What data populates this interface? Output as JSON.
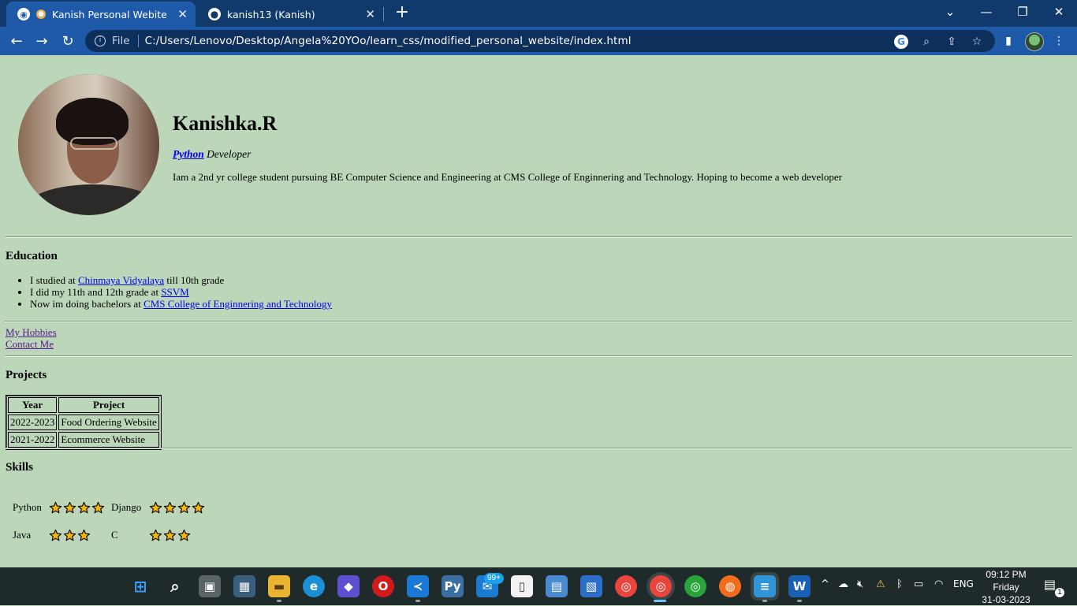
{
  "browser": {
    "tabs": [
      {
        "title": "Kanish Personal Webite",
        "active": true
      },
      {
        "title": "kanish13 (Kanish)",
        "active": false
      }
    ],
    "omnibox": {
      "scheme_label": "File",
      "url": "C:/Users/Lenovo/Desktop/Angela%20YOo/learn_css/modified_personal_website/index.html"
    }
  },
  "profile": {
    "name": "Kanishka.R",
    "role_link": "Python",
    "role_rest": " Developer",
    "bio": "Iam a 2nd yr college student pursuing BE Computer Science and Engineering at CMS College of Enginnering and Technology. Hoping to become a web developer"
  },
  "education": {
    "heading": "Education",
    "items": [
      {
        "prefix": "I studied at ",
        "link": "Chinmaya Vidyalaya",
        "suffix": " till 10th grade"
      },
      {
        "prefix": "I did my 11th and 12th grade at ",
        "link": "SSVM",
        "suffix": ""
      },
      {
        "prefix": "Now im doing bachelors at ",
        "link": "CMS College of Enginnering and Technology",
        "suffix": ""
      }
    ]
  },
  "nav_links": [
    "My Hobbies",
    "Contact Me"
  ],
  "projects": {
    "heading": "Projects",
    "columns": [
      "Year",
      "Project"
    ],
    "rows": [
      [
        "2022-2023",
        "Food Ordering Website"
      ],
      [
        "2021-2022",
        "Ecommerce Website"
      ]
    ]
  },
  "skills": {
    "heading": "Skills",
    "items": [
      {
        "name": "Python",
        "rating": 4
      },
      {
        "name": "Django",
        "rating": 4
      },
      {
        "name": "Java",
        "rating": 3
      },
      {
        "name": "C",
        "rating": 3
      }
    ]
  },
  "taskbar": {
    "mail_badge": "99+",
    "language": "ENG",
    "time": "09:12 PM",
    "day": "Friday",
    "date": "31-03-2023",
    "notification_count": "1"
  },
  "colors": {
    "page_bg": "#bcd6b9",
    "link": "#0000ee",
    "visited_link": "#551a8b",
    "star_fill": "#f5b50a",
    "tab_bar": "#0f3a6b",
    "toolbar": "#1f5aa8"
  }
}
